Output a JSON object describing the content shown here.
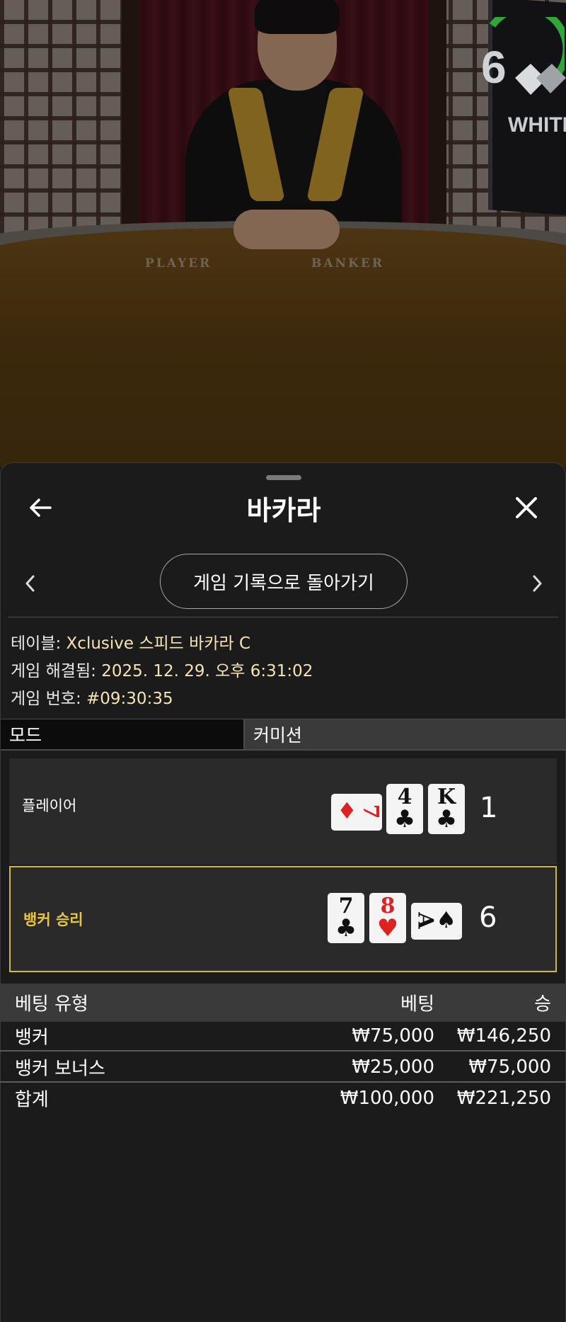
{
  "video": {
    "timer_value": "6",
    "brand_text": "WHITE",
    "felt_player": "PLAYER",
    "felt_banker": "BANKER",
    "timer_color": "#2fa53a"
  },
  "panel": {
    "title": "바카라",
    "back_icon": "arrow-left-icon",
    "close_icon": "close-icon",
    "history_button": "게임 기록으로 돌아가기"
  },
  "info": {
    "table_label": "테이블:",
    "table_value": "Xclusive 스피드 바카라 C",
    "resolved_label": "게임 해결됨:",
    "resolved_value": "2025. 12. 29. 오후 6:31:02",
    "game_no_label": "게임 번호:",
    "game_no_value": "#09:30:35"
  },
  "tabs": {
    "mode": "모드",
    "commission": "커미션"
  },
  "player": {
    "label": "플레이어",
    "score": "1",
    "cards": [
      {
        "rank": "7",
        "suit": "♦",
        "color": "red"
      },
      {
        "rank": "4",
        "suit": "♣",
        "color": "black"
      },
      {
        "rank": "K",
        "suit": "♣",
        "color": "black"
      }
    ]
  },
  "banker": {
    "label": "뱅커 승리",
    "score": "6",
    "cards": [
      {
        "rank": "7",
        "suit": "♣",
        "color": "black"
      },
      {
        "rank": "8",
        "suit": "♥",
        "color": "red"
      },
      {
        "rank": "A",
        "suit": "♠",
        "color": "black"
      }
    ]
  },
  "bets": {
    "headers": [
      "베팅 유형",
      "베팅",
      "승"
    ],
    "rows": [
      {
        "type": "뱅커",
        "bet": "₩75,000",
        "win": "₩146,250"
      },
      {
        "type": "뱅커 보너스",
        "bet": "₩25,000",
        "win": "₩75,000"
      }
    ],
    "total": {
      "type": "합계",
      "bet": "₩100,000",
      "win": "₩221,250"
    }
  },
  "colors": {
    "accent_gold": "#e9c63f",
    "value_text": "#f4e4b6"
  }
}
